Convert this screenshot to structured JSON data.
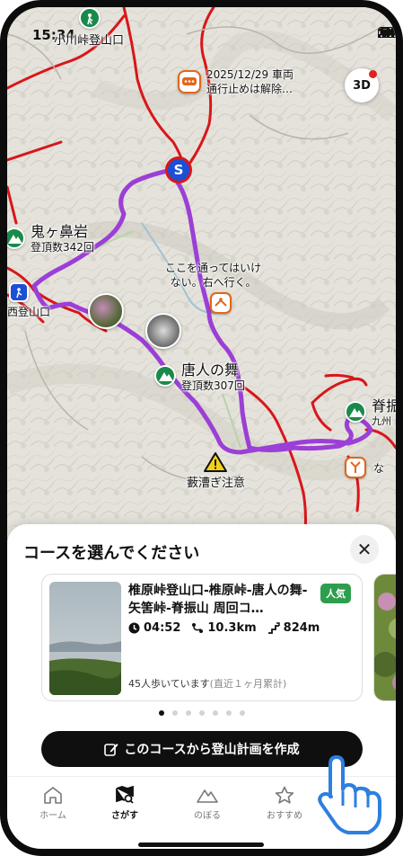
{
  "status_bar": {
    "time": "15:34"
  },
  "map": {
    "trailhead_label": "小川峠登山口",
    "notice": {
      "date_line": "2025/12/29 車両",
      "body_line": "通行止めは解除…"
    },
    "three_d_label": "3D",
    "start_marker": "S",
    "peaks": [
      {
        "name": "鬼ヶ鼻岩",
        "count": "登頂数342回"
      },
      {
        "name": "唐人の舞",
        "count": "登頂数307回"
      },
      {
        "name": "脊振",
        "count": "九州"
      }
    ],
    "left_trailhead": "西登山口",
    "caution_text": "ここを通ってはいけ\nない。右へ行く。",
    "hazard_label": "藪漕ぎ注意",
    "right_edge_text": "な"
  },
  "sheet": {
    "title": "コースを選んでください",
    "close_symbol": "✕",
    "course": {
      "name": "椎原峠登山口-椎原峠-唐人の舞-矢筈峠-脊振山 周回コ…",
      "badge": "人気",
      "time": "04:52",
      "distance": "10.3km",
      "elevation": "824m",
      "walkers": "45人歩いています",
      "walkers_note": "(直近１ヶ月累計)"
    },
    "pagination": {
      "count": 7,
      "active": 0
    },
    "create_button": "このコースから登山計画を作成"
  },
  "tabs": [
    {
      "label": "ホーム",
      "icon": "home-icon"
    },
    {
      "label": "さがす",
      "icon": "map-search-icon",
      "active": true
    },
    {
      "label": "のぼる",
      "icon": "mountain-icon"
    },
    {
      "label": "おすすめ",
      "icon": "star-icon"
    },
    {
      "label": "",
      "icon": "more-icon"
    }
  ],
  "colors": {
    "route": "#9b3fd6",
    "road": "#d9161a",
    "accent_green": "#2e9e4e",
    "pin_green": "#1a8a4a"
  }
}
